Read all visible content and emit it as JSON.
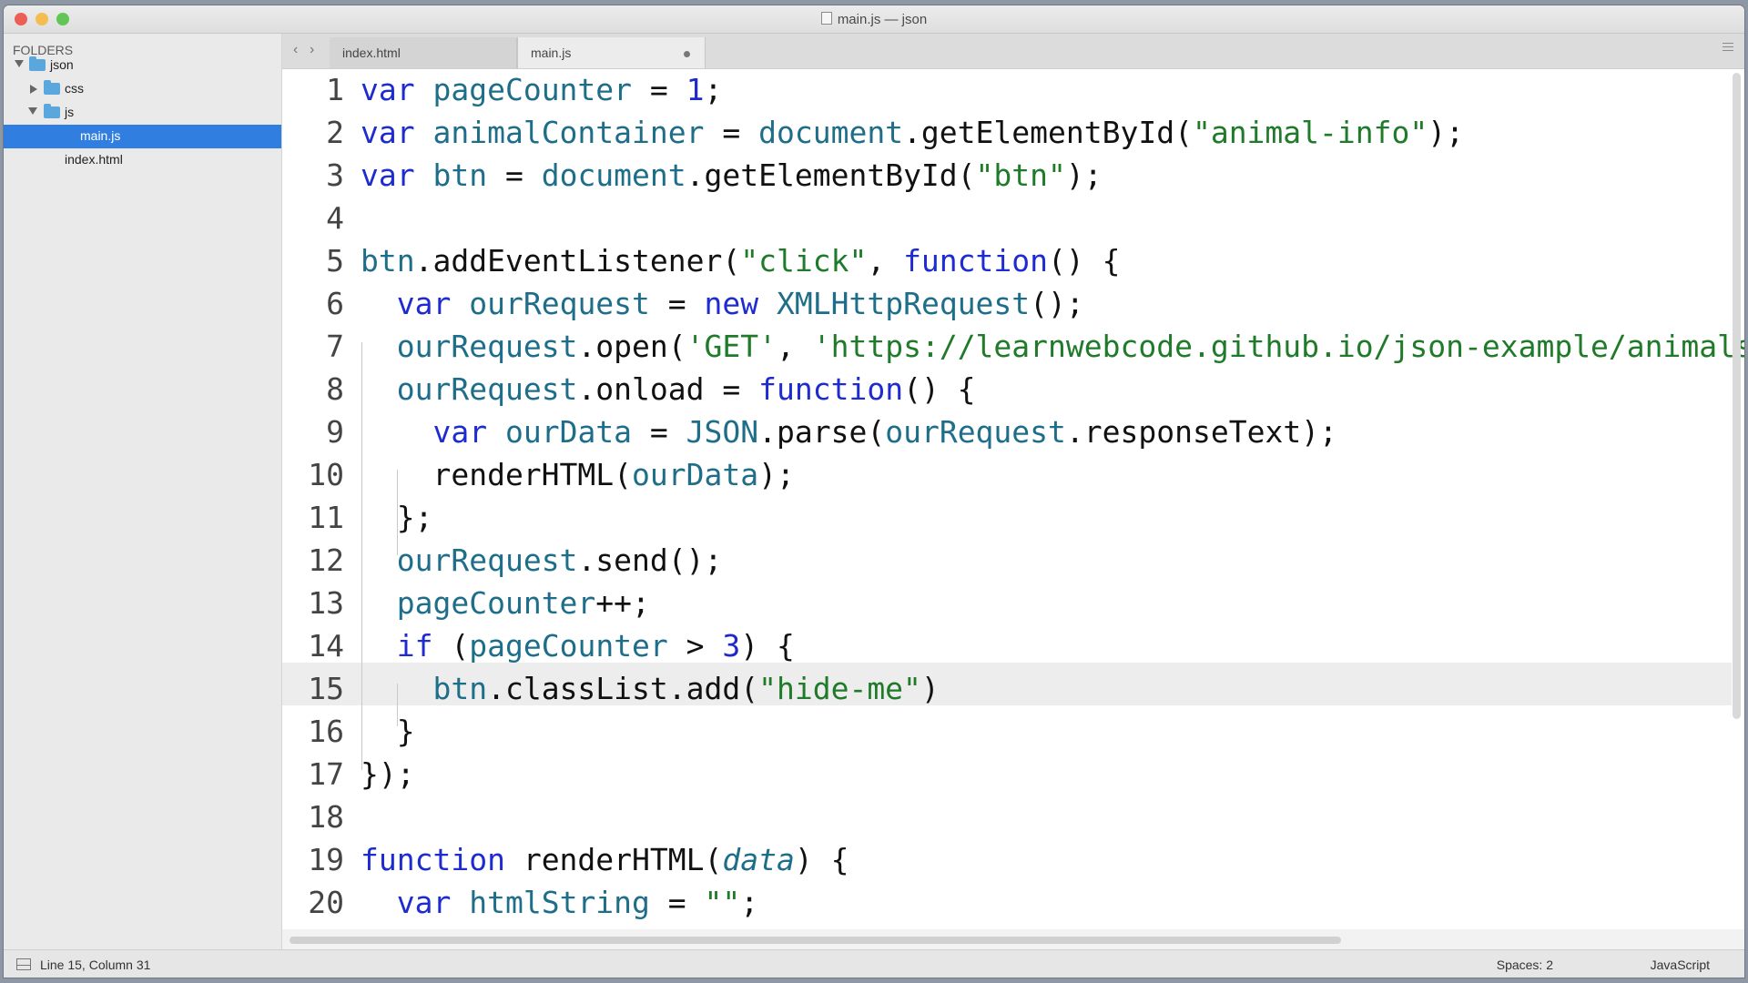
{
  "window": {
    "title": "main.js — json"
  },
  "sidebar": {
    "header": "FOLDERS",
    "tree": [
      {
        "label": "json",
        "type": "folder",
        "expanded": true
      },
      {
        "label": "css",
        "type": "folder",
        "expanded": false
      },
      {
        "label": "js",
        "type": "folder",
        "expanded": true
      },
      {
        "label": "main.js",
        "type": "file",
        "selected": true
      },
      {
        "label": "index.html",
        "type": "file",
        "selected": false
      }
    ]
  },
  "tabs": [
    {
      "label": "index.html",
      "active": false
    },
    {
      "label": "main.js",
      "active": true,
      "unsaved": true
    }
  ],
  "editor": {
    "current_line": 15,
    "lines": [
      "var pageCounter = 1;",
      "var animalContainer = document.getElementById(\"animal-info\");",
      "var btn = document.getElementById(\"btn\");",
      "",
      "btn.addEventListener(\"click\", function() {",
      "  var ourRequest = new XMLHttpRequest();",
      "  ourRequest.open('GET', 'https://learnwebcode.github.io/json-example/animals-",
      "  ourRequest.onload = function() {",
      "    var ourData = JSON.parse(ourRequest.responseText);",
      "    renderHTML(ourData);",
      "  };",
      "  ourRequest.send();",
      "  pageCounter++;",
      "  if (pageCounter > 3) {",
      "    btn.classList.add(\"hide-me\")",
      "  }",
      "});",
      "",
      "function renderHTML(data) {",
      "  var htmlString = \"\";"
    ],
    "line_numbers": [
      "1",
      "2",
      "3",
      "4",
      "5",
      "6",
      "7",
      "8",
      "9",
      "10",
      "11",
      "12",
      "13",
      "14",
      "15",
      "16",
      "17",
      "18",
      "19",
      "20"
    ]
  },
  "status": {
    "position": "Line 15, Column 31",
    "spaces": "Spaces: 2",
    "language": "JavaScript"
  },
  "colors": {
    "keyword": "#1d2bd0",
    "variable": "#1e6e8a",
    "string": "#1f7a2a",
    "selection": "#2f7ee0"
  }
}
